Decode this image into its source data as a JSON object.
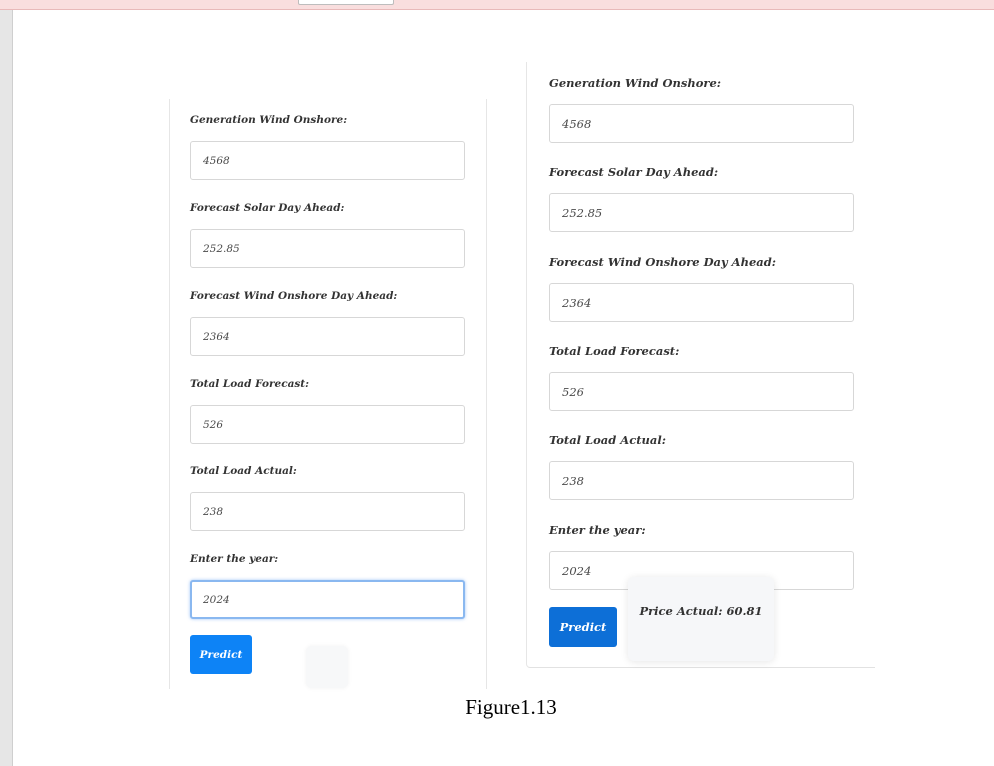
{
  "left_form": {
    "fields": [
      {
        "label": "Generation Wind Onshore:",
        "value": "4568"
      },
      {
        "label": "Forecast Solar Day Ahead:",
        "value": "252.85"
      },
      {
        "label": "Forecast Wind Onshore Day Ahead:",
        "value": "2364"
      },
      {
        "label": "Total Load Forecast:",
        "value": "526"
      },
      {
        "label": "Total Load Actual:",
        "value": "238"
      },
      {
        "label": "Enter the year:",
        "value": "2024"
      }
    ],
    "button_label": "Predict"
  },
  "right_form": {
    "fields": [
      {
        "label": "Generation Wind Onshore:",
        "value": "4568"
      },
      {
        "label": "Forecast Solar Day Ahead:",
        "value": "252.85"
      },
      {
        "label": "Forecast Wind Onshore Day Ahead:",
        "value": "2364"
      },
      {
        "label": "Total Load Forecast:",
        "value": "526"
      },
      {
        "label": "Total Load Actual:",
        "value": "238"
      },
      {
        "label": "Enter the year:",
        "value": "2024"
      }
    ],
    "button_label": "Predict",
    "result_text": "Price Actual: 60.81"
  },
  "caption": "Figure1.13",
  "colors": {
    "primary_button": "#0d83f6",
    "primary_button_dark": "#0d6fd7",
    "focus_ring": "#8ab8f0",
    "top_bar": "#f9dede"
  }
}
